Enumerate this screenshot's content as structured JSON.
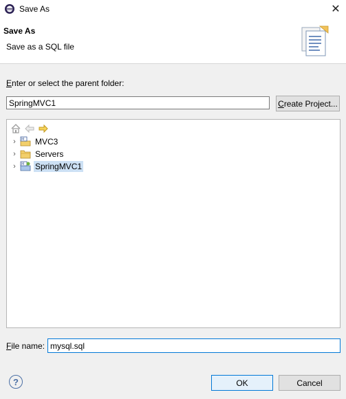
{
  "window": {
    "title": "Save As",
    "close_glyph": "✕"
  },
  "banner": {
    "title": "Save As",
    "description": "Save as a SQL file",
    "icon": "document-save-icon"
  },
  "folder": {
    "label_underlined": "E",
    "label_rest": "nter or select the parent folder:",
    "value": "SpringMVC1",
    "create_project_underlined": "C",
    "create_project_rest": "reate Project..."
  },
  "tree": {
    "toolbar": [
      "home-icon",
      "back-arrow-icon",
      "forward-arrow-icon"
    ],
    "items": [
      {
        "label": "MVC3",
        "icon": "maven-project-icon",
        "selected": false
      },
      {
        "label": "Servers",
        "icon": "folder-icon",
        "selected": false
      },
      {
        "label": "SpringMVC1",
        "icon": "spring-project-icon",
        "selected": true
      }
    ]
  },
  "filename": {
    "label_underlined": "F",
    "label_rest": "ile name:",
    "value": "mysql.sql"
  },
  "buttons": {
    "help": "?",
    "ok": "OK",
    "cancel": "Cancel"
  },
  "colors": {
    "accent": "#0078d7",
    "selection": "#cce0f4"
  }
}
